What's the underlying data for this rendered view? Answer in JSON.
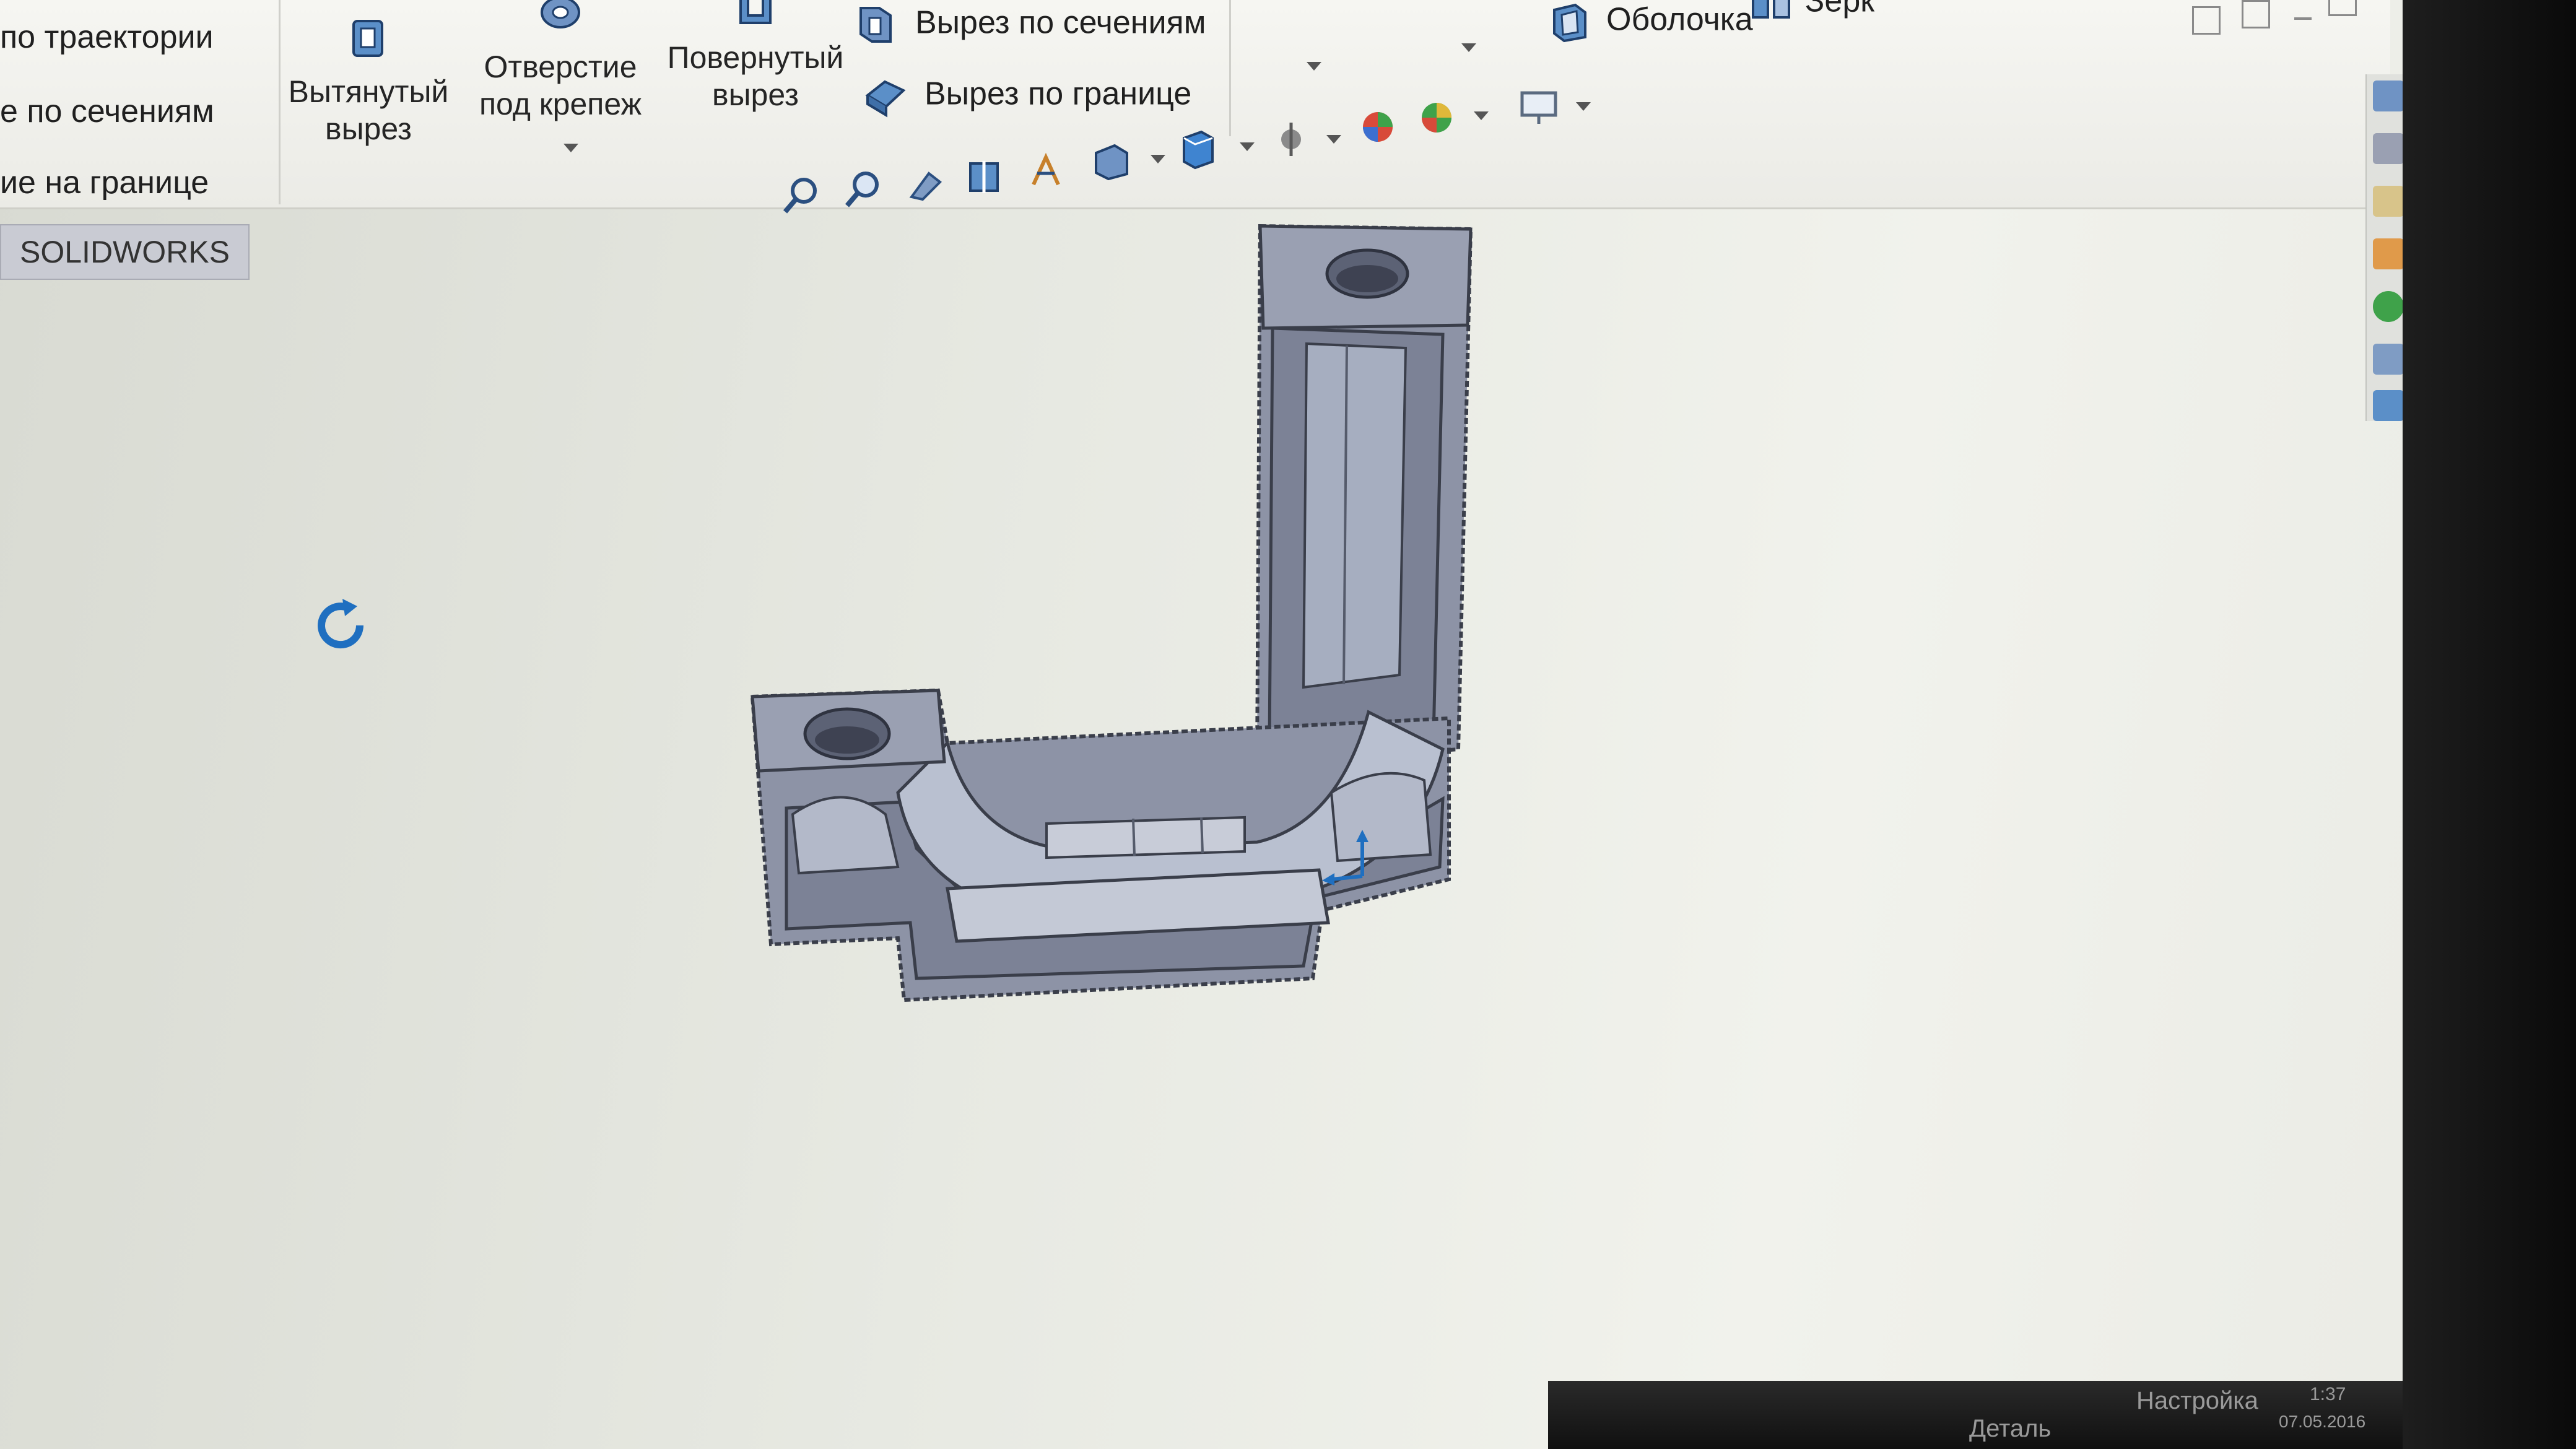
{
  "ribbon": {
    "left_items": [
      "по траектории",
      "е по сечениям",
      "ие на границе"
    ],
    "extruded_cut": {
      "line1": "Вытянутый",
      "line2": "вырез"
    },
    "hole_wizard": {
      "line1": "Отверстие",
      "line2": "под крепеж"
    },
    "revolved_cut": {
      "line1": "Повернутый",
      "line2": "вырез"
    },
    "lofted_cut": "Вырез по сечениям",
    "boundary_cut": "Вырез по границе",
    "shell": "Оболочка",
    "mirror": "Зерк"
  },
  "app_tab": "SOLIDWORKS",
  "status": {
    "part": "Деталь",
    "custom": "Настройка",
    "time": "1:37",
    "date": "07.05.2016"
  },
  "colors": {
    "part_fill": "#9aa0b2",
    "part_face_light": "#c8ccd8",
    "part_face_dark": "#70778c",
    "accent_blue": "#1f6fc0"
  },
  "icons": [
    "zoom-to-fit-icon",
    "zoom-area-icon",
    "previous-view-icon",
    "section-view-icon",
    "dynamic-annotation-icon",
    "view-orientation-icon",
    "display-style-icon",
    "hide-show-icon",
    "edit-appearance-icon",
    "apply-scene-icon",
    "view-settings-icon"
  ]
}
